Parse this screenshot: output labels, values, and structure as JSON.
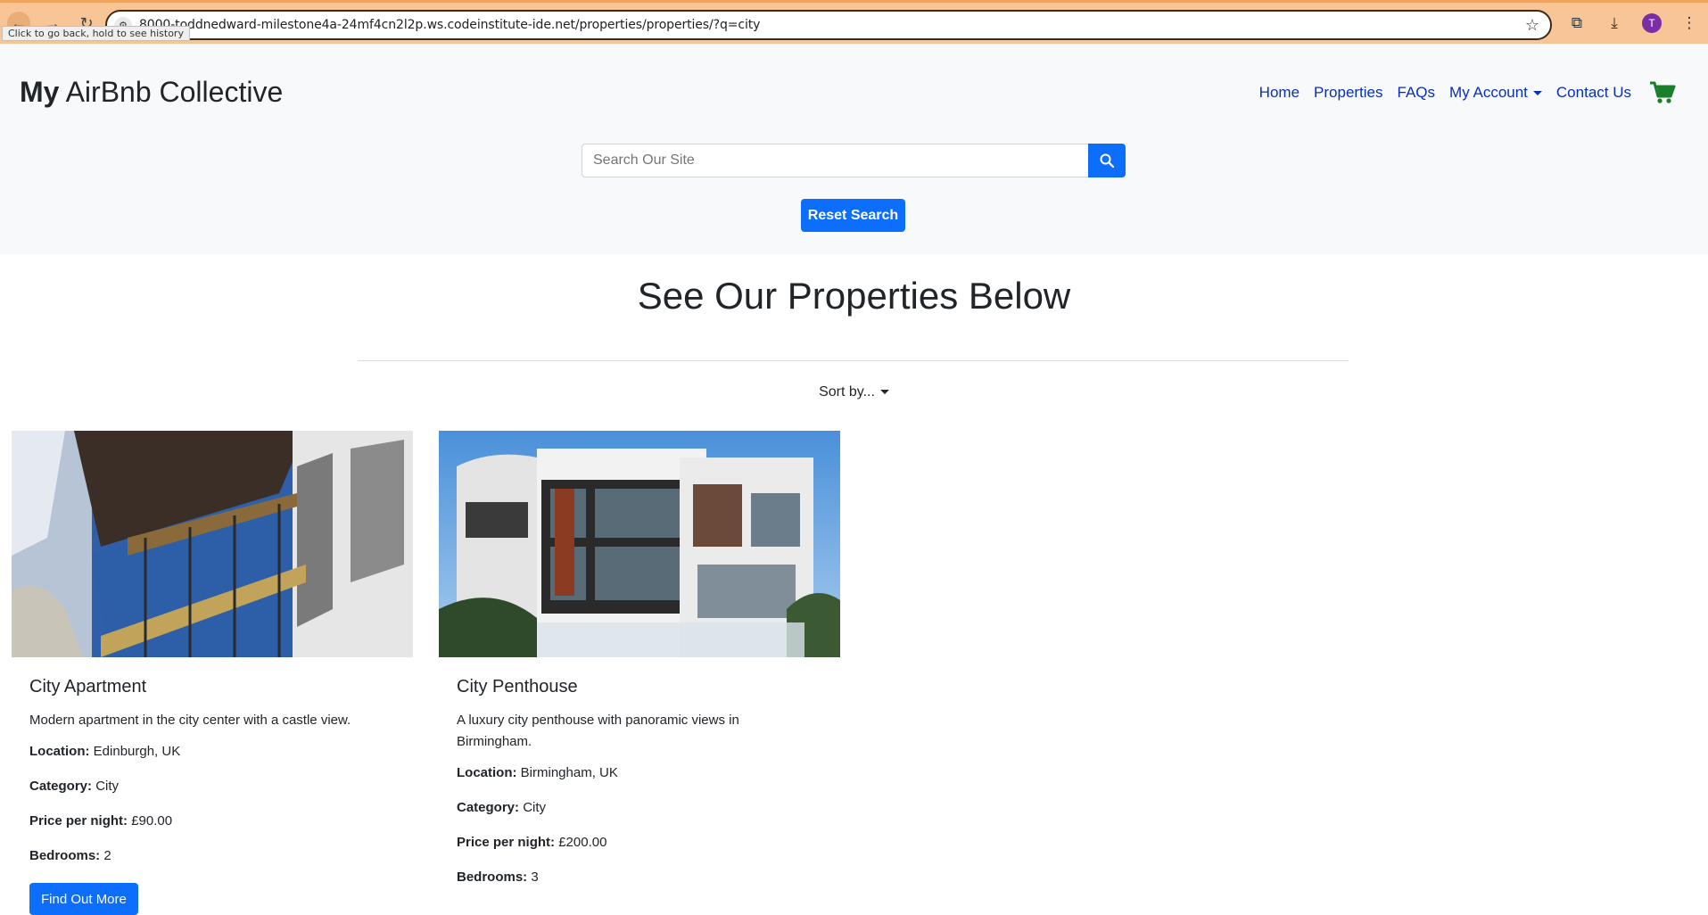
{
  "browser": {
    "url": "8000-toddnedward-milestone4a-24mf4cn2l2p.ws.codeinstitute-ide.net/properties/properties/?q=city",
    "tooltip": "Click to go back, hold to see history",
    "avatar_initial": "T"
  },
  "header": {
    "brand_bold": "My",
    "brand_rest": "AirBnb Collective",
    "nav": [
      "Home",
      "Properties",
      "FAQs",
      "My Account",
      "Contact Us"
    ],
    "search_placeholder": "Search Our Site",
    "reset_label": "Reset Search"
  },
  "main": {
    "title": "See Our Properties Below",
    "sort_label": "Sort by..."
  },
  "labels": {
    "location": "Location:",
    "category": "Category:",
    "price": "Price per night:",
    "bedrooms": "Bedrooms:",
    "button": "Find Out More"
  },
  "properties": [
    {
      "name": "City Apartment",
      "description": "Modern apartment in the city center with a castle view.",
      "location": "Edinburgh, UK",
      "category": "City",
      "price": "£90.00",
      "bedrooms": "2"
    },
    {
      "name": "City Penthouse",
      "description": "A luxury city penthouse with panoramic views in Birmingham.",
      "location": "Birmingham, UK",
      "category": "City",
      "price": "£200.00",
      "bedrooms": "3"
    }
  ],
  "colors": {
    "primary": "#0d6efd",
    "nav_link": "#0a2fb4",
    "cart": "#1a7f2a"
  }
}
